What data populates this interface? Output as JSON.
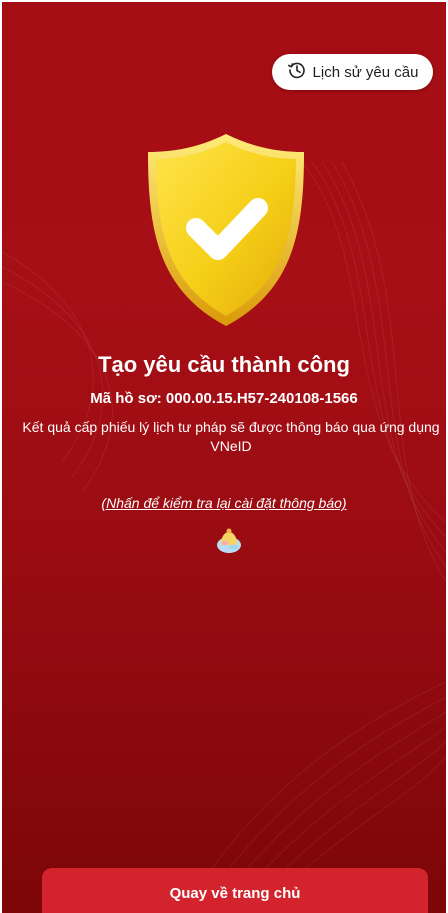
{
  "header": {
    "history_button_label": "Lịch sử yêu cầu",
    "history_icon": "history-clock-icon"
  },
  "result": {
    "status_icon": "shield-check-icon",
    "title": "Tạo yêu cầu thành công",
    "record_code": "Mã hồ sơ: 000.00.15.H57-240108-1566",
    "message": "Kết quả cấp phiếu lý lịch tư pháp sẽ được thông báo qua ứng dụng VNeID",
    "recheck_link": "(Nhấn để kiểm tra lại cài đặt thông báo)",
    "notification_icon": "notification-bell-icon"
  },
  "footer": {
    "home_button_label": "Quay về trang chủ"
  },
  "colors": {
    "background_red": "#a40d13",
    "button_red": "#d3242e",
    "shield_yellow": "#f7d41c",
    "white": "#ffffff"
  }
}
